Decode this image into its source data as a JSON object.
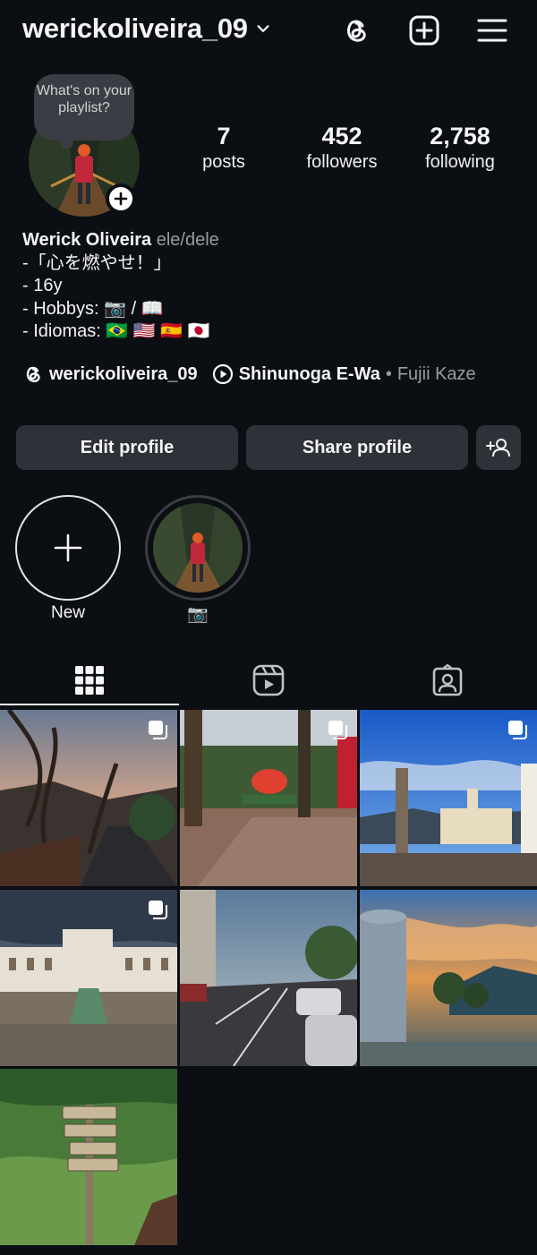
{
  "header": {
    "username": "werickoliveira_09",
    "icons": [
      "chevron-down-icon",
      "threads-icon",
      "new-post-icon",
      "menu-icon"
    ]
  },
  "note": {
    "text": "What's on your playlist?"
  },
  "stats": [
    {
      "value": "7",
      "label": "posts"
    },
    {
      "value": "452",
      "label": "followers"
    },
    {
      "value": "2,758",
      "label": "following"
    }
  ],
  "bio": {
    "name": "Werick Oliveira",
    "pronouns": "ele/dele",
    "lines": [
      "-「心を燃やせ！」",
      "- 16y",
      "- Hobbys: 📷 / 📖",
      "- Idiomas: 🇧🇷 🇺🇸 🇪🇸 🇯🇵"
    ]
  },
  "links": {
    "threads_handle": "werickoliveira_09",
    "song": "Shinunoga E-Wa",
    "separator": "•",
    "artist": "Fujii Kaze"
  },
  "buttons": {
    "edit": "Edit profile",
    "share": "Share profile"
  },
  "highlights": [
    {
      "label": "New"
    },
    {
      "label": "📷"
    }
  ],
  "tabs": [
    "grid-icon",
    "reels-icon",
    "tagged-icon"
  ],
  "colors": {
    "background": "#0b0e13",
    "button": "#2e3137",
    "muted": "#9a9ca0"
  }
}
